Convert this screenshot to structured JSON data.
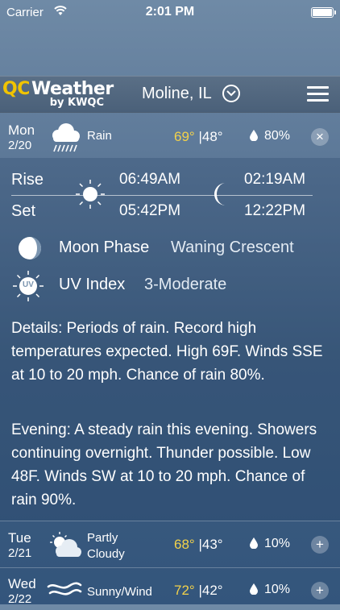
{
  "status_bar": {
    "carrier": "Carrier",
    "time": "2:01 PM"
  },
  "header": {
    "logo_qc": "QC",
    "logo_weather": "Weather",
    "logo_by": "by KWQC",
    "location": "Moline, IL"
  },
  "today": {
    "day": "Mon",
    "date": "2/20",
    "condition": "Rain",
    "high": "69°",
    "low": "48°",
    "precip": "80%",
    "rise_label": "Rise",
    "set_label": "Set",
    "sunrise": "06:49AM",
    "sunset": "05:42PM",
    "moonrise": "02:19AM",
    "moonset": "12:22PM",
    "moon_phase_label": "Moon Phase",
    "moon_phase_value": "Waning Crescent",
    "uv_label": "UV Index",
    "uv_value": "3-Moderate",
    "uv_icon_text": "UV",
    "details": "Details: Periods of rain. Record high temperatures expected. High 69F. Winds SSE at 10 to 20 mph. Chance of rain 80%.",
    "evening": "Evening: A steady rain this evening. Showers continuing overnight. Thunder possible. Low 48F. Winds SW at 10 to 20 mph. Chance of rain 90%."
  },
  "forecast": [
    {
      "day": "Tue",
      "date": "2/21",
      "condition_line1": "Partly",
      "condition_line2": "Cloudy",
      "high": "68°",
      "low": "43°",
      "precip": "10%"
    },
    {
      "day": "Wed",
      "date": "2/22",
      "condition": "Sunny/Wind",
      "high": "72°",
      "low": "42°",
      "precip": "10%"
    }
  ],
  "buttons": {
    "close": "×",
    "expand": "+"
  },
  "colors": {
    "high_temp": "#f3d24a",
    "logo_yellow": "#f1c400"
  }
}
